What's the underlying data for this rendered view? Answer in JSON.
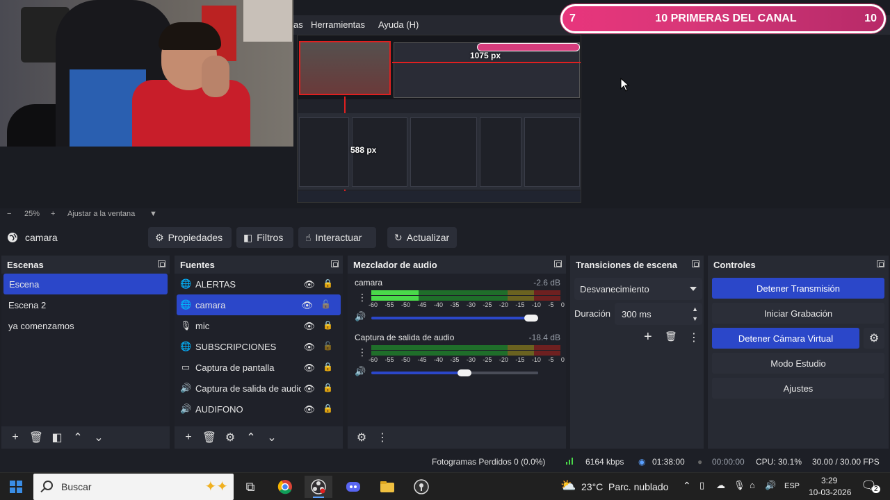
{
  "preview": {
    "nested_menu": {
      "item1": "as",
      "item2": "Herramientas",
      "item3": "Ayuda (H)"
    },
    "nested_label_1075": "1075 px",
    "nested_label_588": "588 px",
    "banner": {
      "left_number": "7",
      "title": "10 PRIMERAS DEL CANAL",
      "right_number": "10"
    }
  },
  "zoom_bar": {
    "minus": "−",
    "percent": "25%",
    "plus": "+",
    "fit_label": "Ajustar a la ventana"
  },
  "source_toolbar": {
    "selected_source": "camara",
    "properties_label": "Propiedades",
    "filters_label": "Filtros",
    "interact_label": "Interactuar",
    "refresh_label": "Actualizar"
  },
  "scenes": {
    "title": "Escenas",
    "items": [
      {
        "label": "Escena"
      },
      {
        "label": "Escena 2"
      },
      {
        "label": "ya comenzamos"
      }
    ]
  },
  "sources": {
    "title": "Fuentes",
    "items": [
      {
        "label": "ALERTAS",
        "icon": "globe-icon"
      },
      {
        "label": "camara",
        "icon": "globe-icon"
      },
      {
        "label": "mic",
        "icon": "microphone-icon"
      },
      {
        "label": "SUBSCRIPCIONES",
        "icon": "globe-icon"
      },
      {
        "label": "Captura de pantalla",
        "icon": "monitor-icon"
      },
      {
        "label": "Captura de salida de audio",
        "icon": "speaker-icon"
      },
      {
        "label": "AUDIFONO",
        "icon": "speaker-icon"
      }
    ]
  },
  "mixer": {
    "title": "Mezclador de audio",
    "scale": [
      "-60",
      "-55",
      "-50",
      "-45",
      "-40",
      "-35",
      "-30",
      "-25",
      "-20",
      "-15",
      "-10",
      "-5",
      "0"
    ],
    "channels": [
      {
        "name": "camara",
        "db": "-2.6 dB",
        "level": 0.25,
        "volume": 0.96
      },
      {
        "name": "Captura de salida de audio",
        "db": "-18.4 dB",
        "level": 0.0,
        "volume": 0.56
      }
    ]
  },
  "transitions": {
    "title": "Transiciones de escena",
    "selected": "Desvanecimiento",
    "duration_label": "Duración",
    "duration_value": "300 ms"
  },
  "controls": {
    "title": "Controles",
    "stop_stream": "Detener Transmisión",
    "start_recording": "Iniciar Grabación",
    "stop_virtual_cam": "Detener Cámara Virtual",
    "studio_mode": "Modo Estudio",
    "settings": "Ajustes"
  },
  "status": {
    "dropped_frames": "Fotogramas Perdidos 0 (0.0%)",
    "bitrate": "6164 kbps",
    "stream_time": "01:38:00",
    "record_time": "00:00:00",
    "cpu": "CPU: 30.1%",
    "fps": "30.00 / 30.00 FPS"
  },
  "taskbar": {
    "search_placeholder": "Buscar",
    "weather_temp": "23°C",
    "weather_desc": "Parc. nublado",
    "language": "ESP",
    "time": "3:29",
    "date": "10-03-2026",
    "notification_count": "2"
  },
  "colors": {
    "accent": "#2b47c9",
    "banner": "#d63c7c",
    "meter_green": "#4ad94a"
  }
}
